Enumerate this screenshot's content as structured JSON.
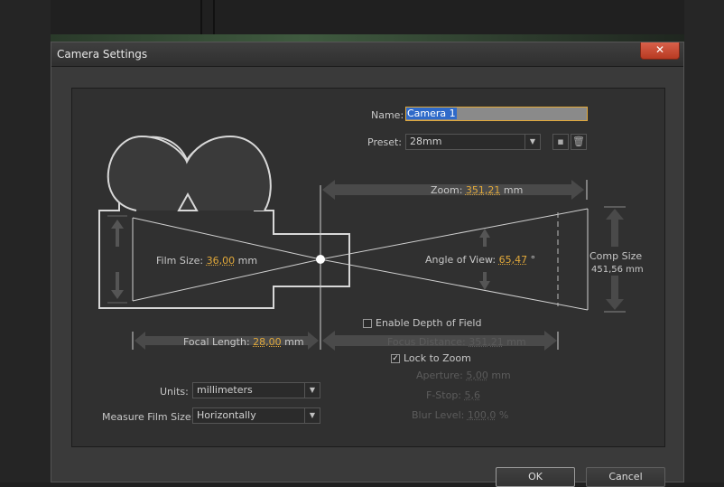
{
  "dialog": {
    "title": "Camera Settings",
    "close_glyph": "✕"
  },
  "name": {
    "label": "Name:",
    "value": "Camera 1"
  },
  "preset": {
    "label": "Preset:",
    "value": "28mm"
  },
  "zoom": {
    "label": "Zoom:",
    "value": "351,21",
    "unit": "mm"
  },
  "comp_size": {
    "label": "Comp Size",
    "value": "451,56 mm"
  },
  "film_size": {
    "label": "Film Size:",
    "value": "36,00",
    "unit": "mm"
  },
  "angle_of_view": {
    "label": "Angle of View:",
    "value": "65,47",
    "unit": "°"
  },
  "focal_length": {
    "label": "Focal Length:",
    "value": "28,00",
    "unit": "mm"
  },
  "depth_of_field": {
    "label": "Enable Depth of Field",
    "checked": false
  },
  "focus_distance": {
    "label": "Focus Distance:",
    "value": "351,21",
    "unit": "mm"
  },
  "lock_to_zoom": {
    "label": "Lock to Zoom",
    "checked": true,
    "check_glyph": "✓"
  },
  "aperture": {
    "label": "Aperture:",
    "value": "5,00",
    "unit": "mm"
  },
  "fstop": {
    "label": "F-Stop:",
    "value": "5,6"
  },
  "blur_level": {
    "label": "Blur Level:",
    "value": "100,0",
    "unit": "%"
  },
  "units": {
    "label": "Units:",
    "value": "millimeters"
  },
  "measure_film_size": {
    "label": "Measure Film Size:",
    "value": "Horizontally"
  },
  "buttons": {
    "ok": "OK",
    "cancel": "Cancel"
  },
  "icons": {
    "dropdown_arrow": "▼",
    "save_preset": "save-preset-icon",
    "delete_preset": "trash-icon"
  },
  "colors": {
    "accent": "#e2a93a",
    "selection": "#2f6ac9",
    "close": "#c8452d"
  }
}
